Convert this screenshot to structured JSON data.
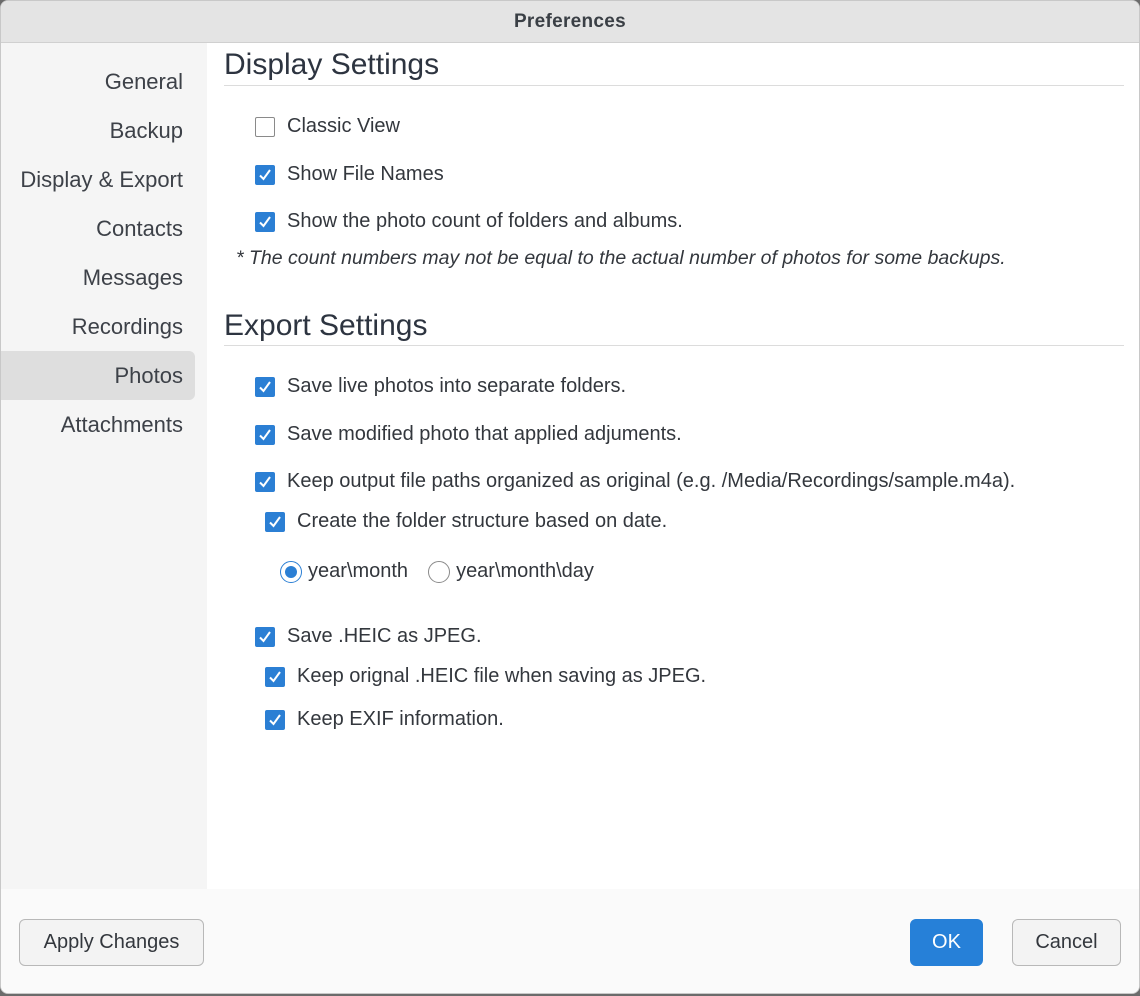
{
  "window": {
    "title": "Preferences"
  },
  "sidebar": {
    "items": [
      {
        "label": "General"
      },
      {
        "label": "Backup"
      },
      {
        "label": "Display & Export"
      },
      {
        "label": "Contacts"
      },
      {
        "label": "Messages"
      },
      {
        "label": "Recordings"
      },
      {
        "label": "Photos",
        "selected": true
      },
      {
        "label": "Attachments"
      }
    ]
  },
  "display_settings": {
    "title": "Display Settings",
    "classic_view": {
      "label": "Classic View",
      "checked": false
    },
    "show_file_names": {
      "label": "Show File Names",
      "checked": true
    },
    "show_photo_count": {
      "label": "Show the photo count of folders and albums.",
      "checked": true
    },
    "note": "* The count numbers may not be equal to the actual number of photos for some backups."
  },
  "export_settings": {
    "title": "Export Settings",
    "save_live_photos": {
      "label": "Save live photos into separate folders.",
      "checked": true
    },
    "save_modified_photo": {
      "label": "Save modified photo that applied adjuments.",
      "checked": true
    },
    "keep_output_paths": {
      "label": "Keep output file paths organized as original (e.g. /Media/Recordings/sample.m4a).",
      "checked": true
    },
    "create_folder_by_date": {
      "label": "Create the folder structure based on date.",
      "checked": true
    },
    "date_structure": {
      "options": [
        {
          "label": "year\\month",
          "selected": true
        },
        {
          "label": "year\\month\\day",
          "selected": false
        }
      ]
    },
    "save_heic_as_jpeg": {
      "label": "Save .HEIC as JPEG.",
      "checked": true
    },
    "keep_original_heic": {
      "label": "Keep orignal .HEIC file when saving as JPEG.",
      "checked": true
    },
    "keep_exif": {
      "label": "Keep EXIF information.",
      "checked": true
    }
  },
  "footer": {
    "apply_label": "Apply Changes",
    "ok_label": "OK",
    "cancel_label": "Cancel"
  },
  "colors": {
    "accent": "#2b7fd4",
    "sidebar_bg": "#f5f5f5",
    "sidebar_selected": "#dedede"
  }
}
